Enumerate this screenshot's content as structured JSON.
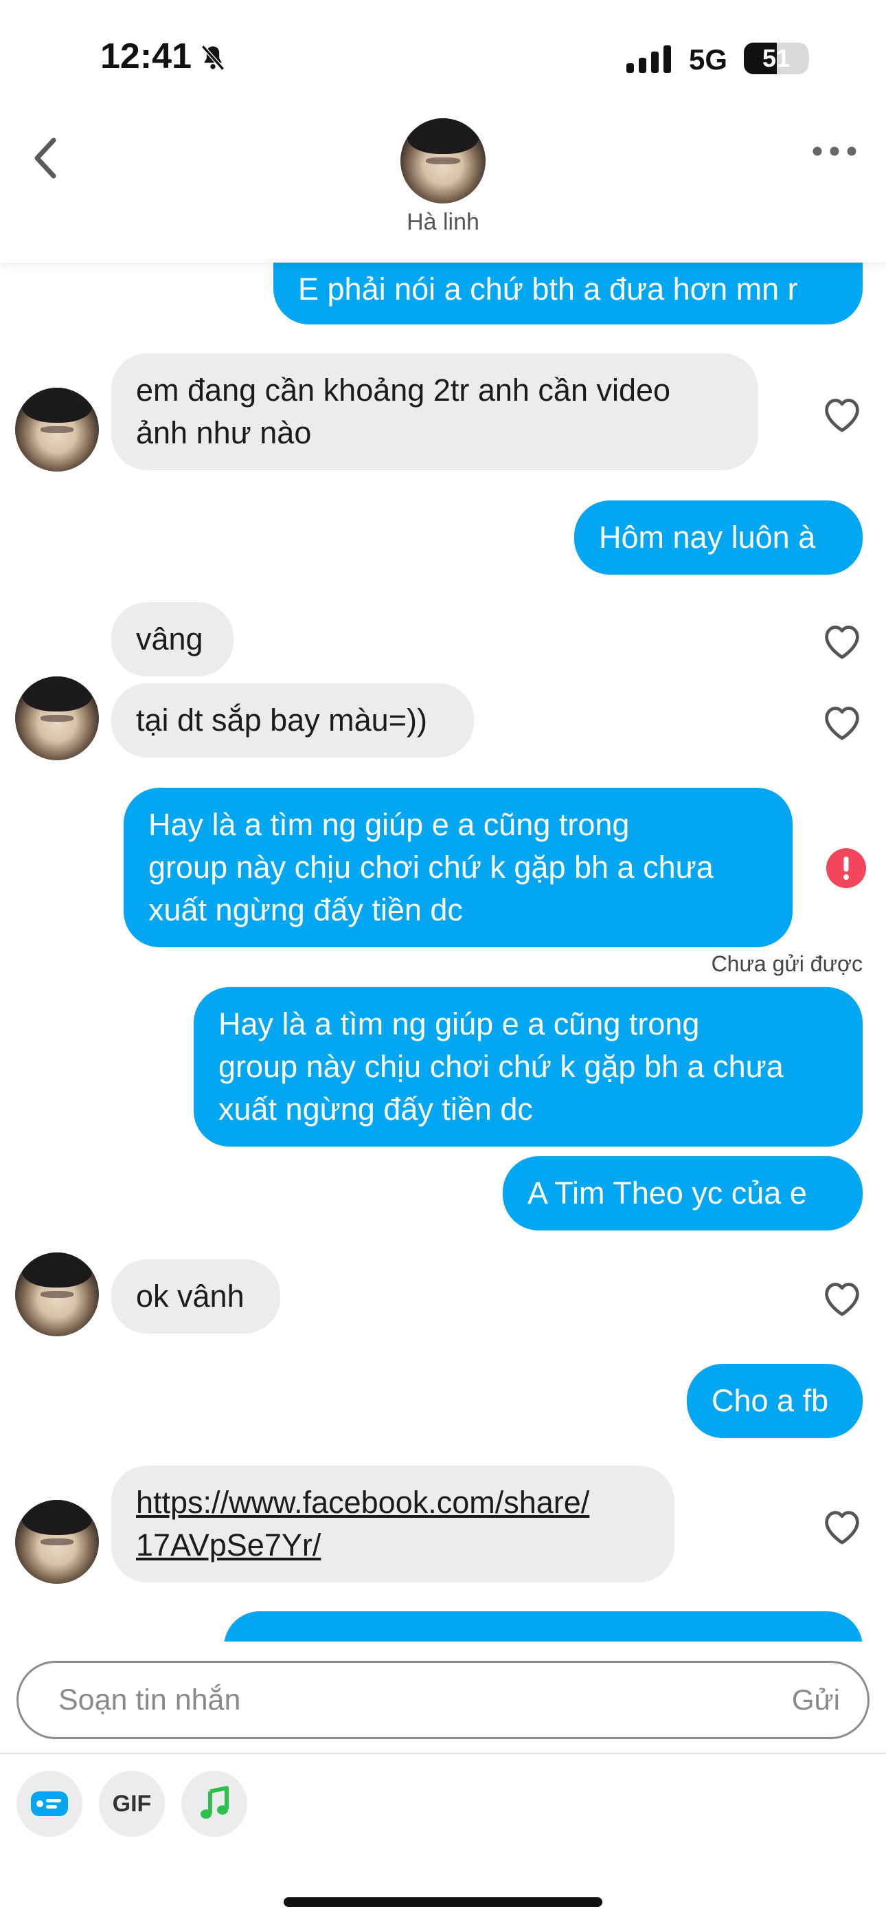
{
  "status_bar": {
    "time": "12:41",
    "network": "5G",
    "battery_level": "51",
    "battery_fraction": 0.51,
    "icons": [
      "bell-slash-icon",
      "cellular-signal-icon",
      "battery-icon"
    ]
  },
  "header": {
    "contact_name": "Hà linh",
    "icons": [
      "chevron-left-icon",
      "more-dots-icon"
    ]
  },
  "messages": [
    {
      "id": 1,
      "direction": "out",
      "text": "E phải nói a chứ bth a đưa hơn mn r"
    },
    {
      "id": 2,
      "direction": "in",
      "text": "em đang cần khoảng 2tr anh cần video\nảnh như nào"
    },
    {
      "id": 3,
      "direction": "out",
      "text": "Hôm nay luôn à"
    },
    {
      "id": 4,
      "direction": "in",
      "text": "vâng"
    },
    {
      "id": 5,
      "direction": "in",
      "text": "tại dt sắp bay màu=))"
    },
    {
      "id": 6,
      "direction": "out",
      "text": "Hay là a tìm ng giúp e a cũng trong\ngroup này chịu chơi chứ k gặp bh a chưa\nxuất ngừng đấy tiền dc",
      "status": "Chưa gửi được"
    },
    {
      "id": 7,
      "direction": "out",
      "text": "Hay là a tìm ng giúp e a cũng trong\ngroup này chịu chơi chứ k gặp bh a chưa\nxuất ngừng đấy tiền dc"
    },
    {
      "id": 8,
      "direction": "out",
      "text": "A Tim Theo yc của e"
    },
    {
      "id": 9,
      "direction": "in",
      "text": "ok vânh"
    },
    {
      "id": 10,
      "direction": "out",
      "text": "Cho a fb"
    },
    {
      "id": 11,
      "direction": "in",
      "text": "https://www.facebook.com/share/\n17AVpSe7Yr/",
      "is_link": true
    }
  ],
  "composer": {
    "placeholder": "Soạn tin nhắn",
    "send_label": "Gửi",
    "gif_label": "GIF",
    "tools": [
      "sticker-icon",
      "gif-button",
      "music-note-icon"
    ]
  },
  "colors": {
    "outgoing_bubble": "#03a6f0",
    "incoming_bubble": "#ececee",
    "error": "#f4465a",
    "music_green": "#2bc04a"
  }
}
